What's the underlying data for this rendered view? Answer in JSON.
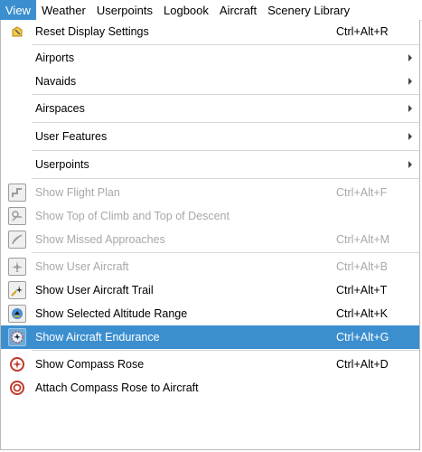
{
  "menubar": {
    "items": [
      "View",
      "Weather",
      "Userpoints",
      "Logbook",
      "Aircraft",
      "Scenery Library"
    ]
  },
  "menu": {
    "reset": {
      "label": "Reset Display Settings",
      "shortcut": "Ctrl+Alt+R"
    },
    "airports": {
      "label": "Airports"
    },
    "navaids": {
      "label": "Navaids"
    },
    "airspaces": {
      "label": "Airspaces"
    },
    "user_features": {
      "label": "User Features"
    },
    "userpoints": {
      "label": "Userpoints"
    },
    "show_flight_plan": {
      "label": "Show Flight Plan",
      "shortcut": "Ctrl+Alt+F"
    },
    "show_toc_tod": {
      "label": "Show Top of Climb and Top of Descent"
    },
    "show_missed": {
      "label": "Show Missed Approaches",
      "shortcut": "Ctrl+Alt+M"
    },
    "show_user_aircraft": {
      "label": "Show User Aircraft",
      "shortcut": "Ctrl+Alt+B"
    },
    "show_trail": {
      "label": "Show User Aircraft Trail",
      "shortcut": "Ctrl+Alt+T"
    },
    "show_altitude_range": {
      "label": "Show Selected Altitude Range",
      "shortcut": "Ctrl+Alt+K"
    },
    "show_endurance": {
      "label": "Show Aircraft Endurance",
      "shortcut": "Ctrl+Alt+G"
    },
    "show_compass": {
      "label": "Show Compass Rose",
      "shortcut": "Ctrl+Alt+D"
    },
    "attach_compass": {
      "label": "Attach Compass Rose to Aircraft"
    }
  },
  "colors": {
    "highlight": "#3c8fcf",
    "disabled_text": "#a8a8a8",
    "accent_red": "#c0392b"
  }
}
